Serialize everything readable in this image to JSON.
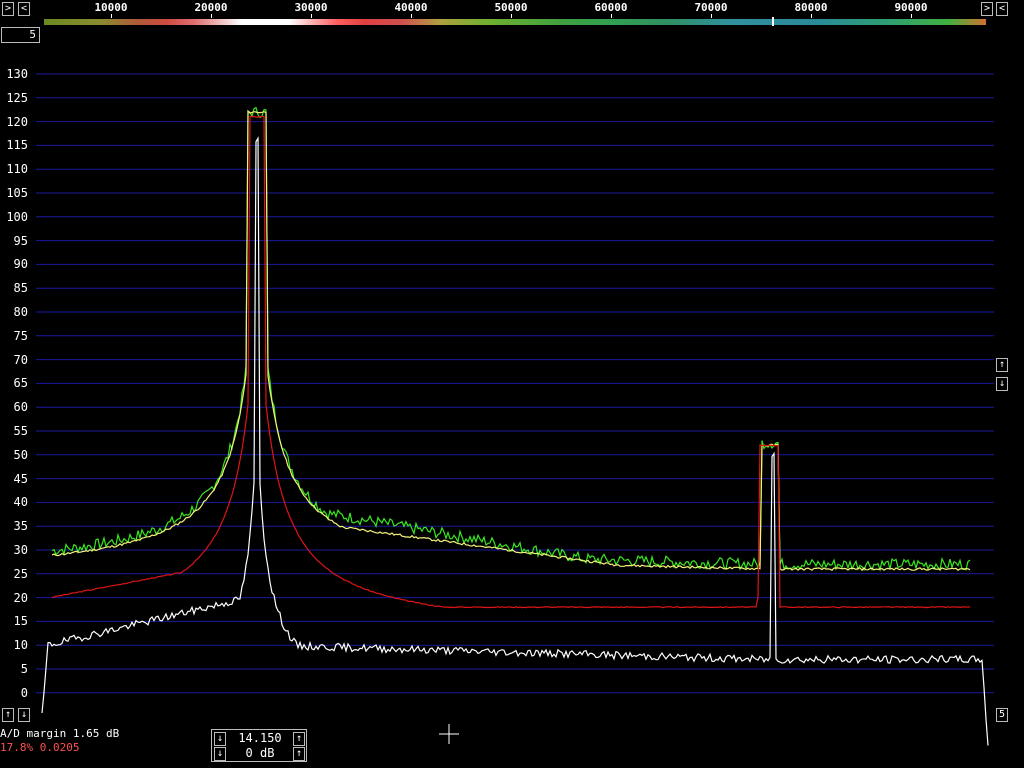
{
  "toolbar": {
    "scroll_left_icon": "arrow-left-icon",
    "freq_labels": [
      "10000",
      "20000",
      "30000",
      "40000",
      "50000",
      "60000",
      "70000",
      "80000",
      "90000"
    ],
    "zoom_right_icon": "arrow-right-icon"
  },
  "corner_box": {
    "label": "5"
  },
  "y_axis": {
    "labels": [
      "130",
      "125",
      "120",
      "115",
      "110",
      "105",
      "100",
      "95",
      "90",
      "85",
      "80",
      "75",
      "70",
      "65",
      "60",
      "55",
      "50",
      "45",
      "40",
      "35",
      "30",
      "25",
      "20",
      "15",
      "10",
      "5",
      "0"
    ]
  },
  "right_controls": {
    "up_icon": "arrow-up-icon",
    "down_icon": "arrow-down-icon",
    "bottom_label": "5"
  },
  "status": {
    "ad_margin": "A/D margin 1.65 dB",
    "ratio": "17.8% 0.0205"
  },
  "center_controls": {
    "value": "14.150",
    "gain": "0 dB"
  },
  "colors": {
    "grid": "#1a1aa0",
    "green": "#39e81e",
    "yellow": "#f4f27a",
    "red": "#e01414",
    "white": "#ffffff"
  }
}
